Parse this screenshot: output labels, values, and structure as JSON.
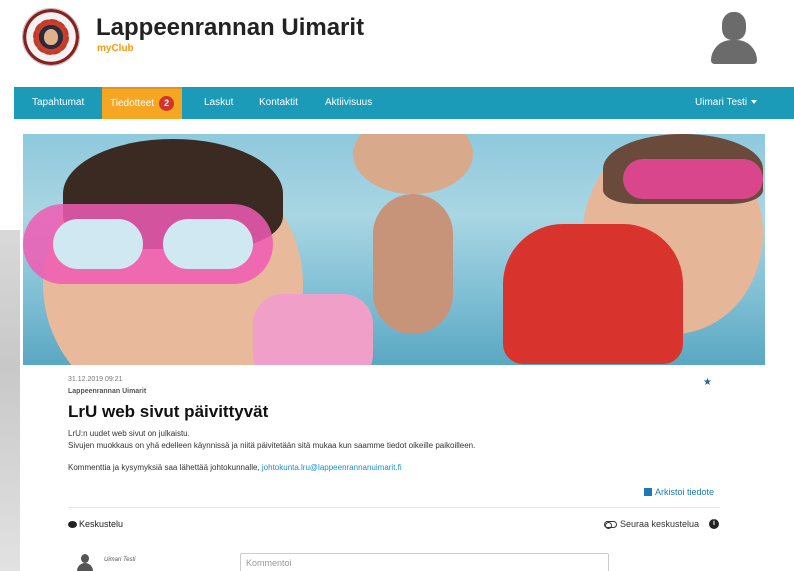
{
  "header": {
    "club_name": "Lappeenrannan Uimarit",
    "club_sub": "myClub"
  },
  "nav": {
    "items": [
      {
        "label": "Tapahtumat"
      },
      {
        "label": "Tiedotteet",
        "badge": "2",
        "active": true
      },
      {
        "label": "Laskut"
      },
      {
        "label": "Kontaktit"
      },
      {
        "label": "Aktiivisuus"
      }
    ],
    "user_menu": "Uimari Testi"
  },
  "post": {
    "date": "31.12.2019 09:21",
    "author": "Lappeenrannan Uimarit",
    "title": "LrU web sivut päivittyvät",
    "line1": "LrU:n uudet web sivut on julkaistu.",
    "line2": "Sivujen muokkaus on yhä edelleen käynnissä ja niitä päivitetään sitä mukaa kun saamme tiedot oikeille paikoilleen.",
    "line3_prefix": "Kommenttia ja kysymyksiä saa lähettää johtokunnalle,",
    "email": "johtokunta.lru@lappeenrannanuimarit.fi"
  },
  "actions": {
    "archive": "Arkistoi tiedote",
    "discussion": "Keskustelu",
    "follow": "Seuraa keskustelua"
  },
  "comment": {
    "user": "Uimari Testi",
    "placeholder": "Kommentoi"
  },
  "icons": [
    "logo",
    "avatar-icon",
    "star-icon",
    "archive-icon",
    "comment-bubble-icon",
    "toggle-icon",
    "info-icon"
  ],
  "colors": {
    "nav_bg": "#1b9bb8",
    "nav_active": "#f5a623",
    "badge": "#d0342c",
    "accent_text": "#f39c12",
    "link": "#1b8fc9"
  }
}
